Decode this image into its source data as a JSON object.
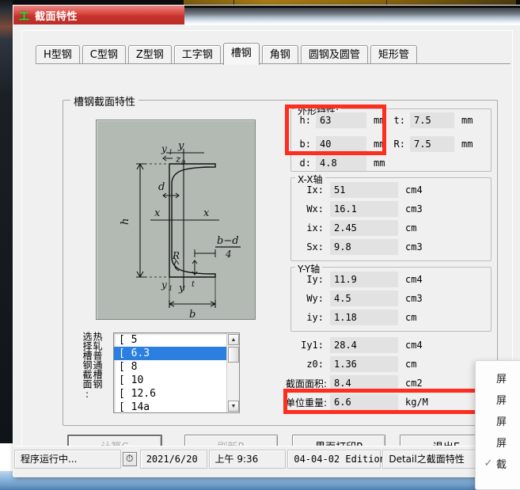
{
  "window": {
    "title": "截面特性",
    "icon": "工"
  },
  "tabs": [
    {
      "label": "H型钢",
      "active": false
    },
    {
      "label": "C型钢",
      "active": false
    },
    {
      "label": "Z型钢",
      "active": false
    },
    {
      "label": "工字钢",
      "active": false
    },
    {
      "label": "槽钢",
      "active": true
    },
    {
      "label": "角钢",
      "active": false
    },
    {
      "label": "圆钢及圆管",
      "active": false
    },
    {
      "label": "矩形管",
      "active": false
    }
  ],
  "main_group": {
    "title": "槽钢截面特性"
  },
  "diagram": {
    "labels": {
      "y_top": "y",
      "y1_top": "y1",
      "z0": "z0",
      "d": "d",
      "h": "h",
      "x_left": "x",
      "x_right": "x",
      "R": "R",
      "formula_num": "b−d",
      "formula_den": "4",
      "t": "t",
      "y1_bottom": "y1",
      "y_bottom": "y",
      "b": "b"
    }
  },
  "selector": {
    "label_right": "热轧普通槽钢",
    "label_left": "选择槽钢截面:",
    "items": [
      "[ 5",
      "[ 6.3",
      "[ 8",
      "[ 10",
      "[ 12.6",
      "[ 14a"
    ],
    "selected_index": 1
  },
  "shape_group": {
    "title": "外形特性:",
    "fields": [
      {
        "label": "h:",
        "value": "63",
        "unit": "mm"
      },
      {
        "label": "t:",
        "value": "7.5",
        "unit": "mm"
      },
      {
        "label": "b:",
        "value": "40",
        "unit": "mm"
      },
      {
        "label": "R:",
        "value": "7.5",
        "unit": "mm"
      },
      {
        "label": "d:",
        "value": "4.8",
        "unit": "mm"
      }
    ]
  },
  "xx_group": {
    "title": "X-X轴",
    "fields": [
      {
        "label": "Ix:",
        "value": "51",
        "unit": "cm4"
      },
      {
        "label": "Wx:",
        "value": "16.1",
        "unit": "cm3"
      },
      {
        "label": "ix:",
        "value": "2.45",
        "unit": "cm"
      },
      {
        "label": "Sx:",
        "value": "9.8",
        "unit": "cm3"
      }
    ]
  },
  "yy_group": {
    "title": "Y-Y轴",
    "fields": [
      {
        "label": "Iy:",
        "value": "11.9",
        "unit": "cm4"
      },
      {
        "label": "Wy:",
        "value": "4.5",
        "unit": "cm3"
      },
      {
        "label": "iy:",
        "value": "1.18",
        "unit": "cm"
      }
    ]
  },
  "extra_fields": [
    {
      "label": "Iy1:",
      "value": "28.4",
      "unit": "cm4",
      "cjk": false
    },
    {
      "label": "z0:",
      "value": "1.36",
      "unit": "cm",
      "cjk": false
    },
    {
      "label": "截面面积:",
      "value": "8.4",
      "unit": "cm2",
      "cjk": true
    },
    {
      "label": "单位重量:",
      "value": "6.6",
      "unit": "kg/M",
      "cjk": true
    }
  ],
  "buttons": [
    {
      "label": "计算C",
      "accel": "C",
      "text": "计算",
      "disabled": true,
      "default": true
    },
    {
      "label": "刷新R",
      "accel": "R",
      "text": "刷新",
      "disabled": true,
      "default": false
    },
    {
      "label": "界面打印P",
      "accel": "P",
      "text": "界面打印",
      "disabled": false,
      "default": false
    },
    {
      "label": "退出E",
      "accel": "E",
      "text": "退出",
      "disabled": false,
      "default": false
    }
  ],
  "status_bar": {
    "running": "程序运行中...",
    "clock_icon": "⏱",
    "date": "2021/6/20",
    "time": "上午 9:36",
    "edition": "04-04-02 Edition",
    "module": "Detail之截面特性"
  },
  "context_menu": {
    "items": [
      {
        "text": "屏",
        "checked": false
      },
      {
        "text": "屏",
        "checked": false
      },
      {
        "text": "屏",
        "checked": false
      },
      {
        "text": "屏",
        "checked": false
      },
      {
        "text": "截",
        "checked": true
      }
    ],
    "check_glyph": "✓"
  },
  "colors": {
    "title_bar": "#cc352f",
    "annotation_red": "#ff2d20",
    "selection_blue": "#2a7fe0",
    "diagram_bg": "#b3bab3",
    "field_bg": "#e2e2e2",
    "window_bg": "#f0f0f0"
  },
  "annotations": [
    {
      "name": "highlight-h-b"
    },
    {
      "name": "highlight-unit-weight"
    }
  ]
}
